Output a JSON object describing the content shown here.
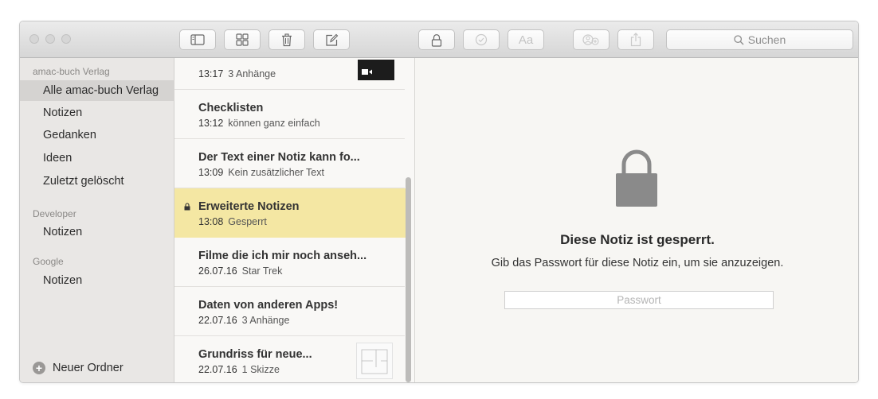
{
  "window": {
    "traffic_colors": [
      "#d6d6d6",
      "#d6d6d6",
      "#d6d6d6"
    ],
    "accent_selected_note": "#f4e7a3"
  },
  "toolbar": {
    "buttons": [
      {
        "icon": "sidebar-toggle-icon"
      },
      {
        "icon": "attachments-grid-icon"
      },
      {
        "icon": "trash-icon"
      },
      {
        "icon": "compose-icon"
      },
      {
        "icon": "lock-icon"
      },
      {
        "icon": "checklist-icon",
        "disabled": true
      },
      {
        "icon": "font-icon",
        "label": "Aa",
        "disabled": true
      },
      {
        "icon": "add-people-icon",
        "disabled": true
      },
      {
        "icon": "share-icon",
        "disabled": true
      }
    ],
    "search_placeholder": "Suchen"
  },
  "sidebar": {
    "sections": [
      {
        "title": "amac-buch Verlag",
        "items": [
          "Alle amac-buch Verlag",
          "Notizen",
          "Gedanken",
          "Ideen",
          "Zuletzt gelöscht"
        ],
        "selected": 0
      },
      {
        "title": "Developer",
        "items": [
          "Notizen"
        ]
      },
      {
        "title": "Google",
        "items": [
          "Notizen"
        ]
      }
    ],
    "new_folder_label": "Neuer Ordner"
  },
  "notes": [
    {
      "title": "",
      "time": "13:17",
      "preview": "3 Anhänge",
      "thumbnail": "video-thumbnail"
    },
    {
      "title": "Checklisten",
      "time": "13:12",
      "preview": "können ganz einfach"
    },
    {
      "title": "Der Text einer Notiz kann fo...",
      "time": "13:09",
      "preview": "Kein zusätzlicher Text"
    },
    {
      "title": "Erweiterte Notizen",
      "time": "13:08",
      "preview": "Gesperrt",
      "locked": true,
      "selected": true
    },
    {
      "title": "Filme die ich mir noch anseh...",
      "time": "26.07.16",
      "preview": "Star Trek"
    },
    {
      "title": "Daten von anderen Apps!",
      "time": "22.07.16",
      "preview": "3 Anhänge"
    },
    {
      "title": "Grundriss für neue...",
      "time": "22.07.16",
      "preview": "1 Skizze",
      "thumbnail": "sketch-thumbnail"
    }
  ],
  "detail": {
    "locked_title": "Diese Notiz ist gesperrt.",
    "locked_message": "Gib das Passwort für diese Notiz ein, um sie anzuzeigen.",
    "password_placeholder": "Passwort"
  }
}
